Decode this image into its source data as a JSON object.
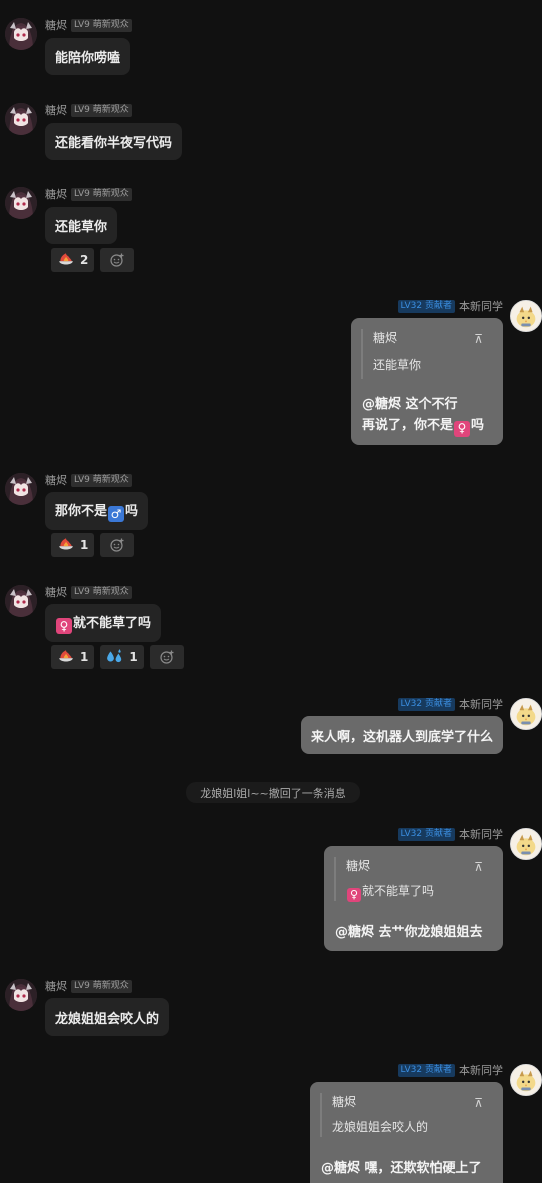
{
  "users": {
    "left_name": "糖烬",
    "left_badge": "LV9 萌新观众",
    "right_name": "本新同学",
    "right_badge": "LV32 贡献者"
  },
  "messages": {
    "m1": {
      "text": "能陪你唠嗑"
    },
    "m2": {
      "text": "还能看你半夜写代码"
    },
    "m3": {
      "text": "还能草你",
      "reaction_count": "2"
    },
    "m4": {
      "quote_name": "糖烬",
      "quote_text": "还能草你",
      "pin": "⊼",
      "line1": "@糖烬 这个不行",
      "line2_before": "再说了，你不是",
      "line2_emoji": "♀",
      "line2_after": "吗"
    },
    "m5": {
      "before": "那你不是",
      "emoji": "♂",
      "after": "吗",
      "reaction_count": "1"
    },
    "m6": {
      "emoji": "♀",
      "text": "就不能草了吗",
      "reaction1_count": "1",
      "reaction2_count": "1"
    },
    "m7": {
      "text": "来人啊，这机器人到底学了什么"
    },
    "system": {
      "text": "龙娘姐l姐l~~撤回了一条消息"
    },
    "m8": {
      "quote_name": "糖烬",
      "quote_emoji": "♀",
      "quote_text": "就不能草了吗",
      "pin": "⊼",
      "text": "@糖烬 去艹你龙娘姐姐去"
    },
    "m9": {
      "text": "龙娘姐姐会咬人的"
    },
    "m10": {
      "quote_name": "糖烬",
      "quote_text": "龙娘姐姐会咬人的",
      "pin": "⊼",
      "text": "@糖烬 嘿，还欺软怕硬上了"
    }
  },
  "colors": {
    "background": "#111111",
    "left_bubble": "#242424",
    "right_bubble": "#6a6a6a",
    "female_emoji": "#e0457b",
    "male_emoji": "#3b78d6"
  },
  "icons": {
    "reaction_fire": "fire-bowl-icon",
    "reaction_sweat": "sweat-droplets-icon",
    "add_reaction": "add-emoji-icon"
  }
}
